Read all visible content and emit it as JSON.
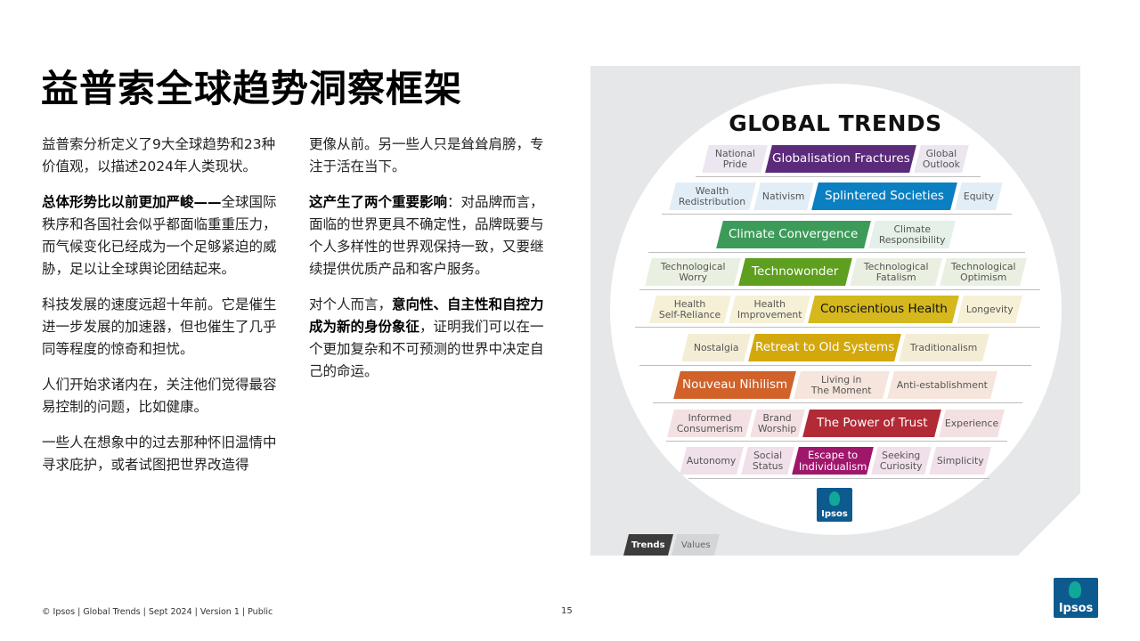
{
  "page": {
    "title": "益普索全球趋势洞察框架",
    "footer": "© Ipsos | Global Trends | Sept 2024 | Version 1 | Public",
    "page_number": "15",
    "logo_text": "Ipsos"
  },
  "text": {
    "left": {
      "p1": "益普索分析定义了9大全球趋势和23种价值观，以描述2024年人类现状。",
      "p2_bold": "总体形势比以前更加严峻——",
      "p2_rest": "全球国际秩序和各国社会似乎都面临重重压力，而气候变化已经成为一个足够紧迫的威胁，足以让全球舆论团结起来。",
      "p3": "科技发展的速度远超十年前。它是催生进一步发展的加速器，但也催生了几乎同等程度的惊奇和担忧。",
      "p4": "人们开始求诸内在，关注他们觉得最容易控制的问题，比如健康。",
      "p5": "一些人在想象中的过去那种怀旧温情中寻求庇护，或者试图把世界改造得"
    },
    "mid": {
      "p1": "更像从前。另一些人只是耸耸肩膀，专注于活在当下。",
      "p2_bold": "这产生了两个重要影响",
      "p2_rest": "：对品牌而言，面临的世界更具不确定性，品牌既要与个人多样性的世界观保持一致，又要继续提供优质产品和客户服务。",
      "p3_start": "对个人而言，",
      "p3_bold": "意向性、自主性和自控力成为新的身份象征",
      "p3_rest": "，证明我们可以在一个更加复杂和不可预测的世界中决定自己的命运。"
    }
  },
  "framework": {
    "title": "GLOBAL TRENDS",
    "tabs": {
      "trends": "Trends",
      "values": "Values"
    },
    "colors": {
      "purple": "#5b2a7a",
      "blue": "#0a7fc2",
      "green": "#3d9b5a",
      "olive": "#5e9f1f",
      "gold": "#d4b81e",
      "amber": "#d3a80c",
      "orange": "#d0622a",
      "red": "#b12a36",
      "magenta": "#a0166b"
    },
    "rows": [
      {
        "chips": [
          {
            "kind": "val",
            "label": "National\nPride",
            "color": "#ece6f1"
          },
          {
            "kind": "trend",
            "label": "Globalisation Fractures",
            "color": "#5b2a7a"
          },
          {
            "kind": "val",
            "label": "Global\nOutlook",
            "color": "#ece6f1"
          }
        ]
      },
      {
        "chips": [
          {
            "kind": "val",
            "label": "Wealth\nRedistribution",
            "color": "#e2eef7"
          },
          {
            "kind": "val",
            "label": "Nativism",
            "color": "#e2eef7"
          },
          {
            "kind": "trend",
            "label": "Splintered Societies",
            "color": "#0a7fc2"
          },
          {
            "kind": "val",
            "label": "Equity",
            "color": "#e2eef7"
          }
        ]
      },
      {
        "chips": [
          {
            "kind": "trend",
            "label": "Climate Convergence",
            "color": "#3d9b5a"
          },
          {
            "kind": "val",
            "label": "Climate\nResponsibility",
            "color": "#e5f0e8"
          }
        ]
      },
      {
        "chips": [
          {
            "kind": "val",
            "label": "Technological\nWorry",
            "color": "#e9f0e1"
          },
          {
            "kind": "trend",
            "label": "Technowonder",
            "color": "#5e9f1f"
          },
          {
            "kind": "val",
            "label": "Technological\nFatalism",
            "color": "#e9f0e1"
          },
          {
            "kind": "val",
            "label": "Technological\nOptimism",
            "color": "#e9f0e1"
          }
        ]
      },
      {
        "chips": [
          {
            "kind": "val",
            "label": "Health\nSelf-Reliance",
            "color": "#f5f0d6"
          },
          {
            "kind": "val",
            "label": "Health\nImprovement",
            "color": "#f5f0d6"
          },
          {
            "kind": "trend",
            "label": "Conscientious Health",
            "color": "#d4b81e",
            "text": "#111111"
          },
          {
            "kind": "val",
            "label": "Longevity",
            "color": "#f5f0d6"
          }
        ]
      },
      {
        "chips": [
          {
            "kind": "val",
            "label": "Nostalgia",
            "color": "#f4edd6"
          },
          {
            "kind": "trend",
            "label": "Retreat to Old Systems",
            "color": "#d3a80c"
          },
          {
            "kind": "val",
            "label": "Traditionalism",
            "color": "#f4edd6"
          }
        ]
      },
      {
        "chips": [
          {
            "kind": "trend",
            "label": "Nouveau Nihilism",
            "color": "#d0622a"
          },
          {
            "kind": "val",
            "label": "Living in\nThe Moment",
            "color": "#f6e5dc"
          },
          {
            "kind": "val",
            "label": "Anti-establishment",
            "color": "#f6e5dc"
          }
        ]
      },
      {
        "chips": [
          {
            "kind": "val",
            "label": "Informed\nConsumerism",
            "color": "#f3e0e2"
          },
          {
            "kind": "val",
            "label": "Brand\nWorship",
            "color": "#f3e0e2"
          },
          {
            "kind": "trend",
            "label": "The Power of Trust",
            "color": "#b12a36"
          },
          {
            "kind": "val",
            "label": "Experience",
            "color": "#f3e0e2"
          }
        ]
      },
      {
        "chips": [
          {
            "kind": "val",
            "label": "Autonomy",
            "color": "#f0e0ea"
          },
          {
            "kind": "val",
            "label": "Social\nStatus",
            "color": "#f0e0ea"
          },
          {
            "kind": "trend",
            "label": "Escape to\nIndividualism",
            "color": "#a0166b",
            "small": true
          },
          {
            "kind": "val",
            "label": "Seeking\nCuriosity",
            "color": "#f0e0ea"
          },
          {
            "kind": "val",
            "label": "Simplicity",
            "color": "#f0e0ea"
          }
        ]
      }
    ]
  }
}
